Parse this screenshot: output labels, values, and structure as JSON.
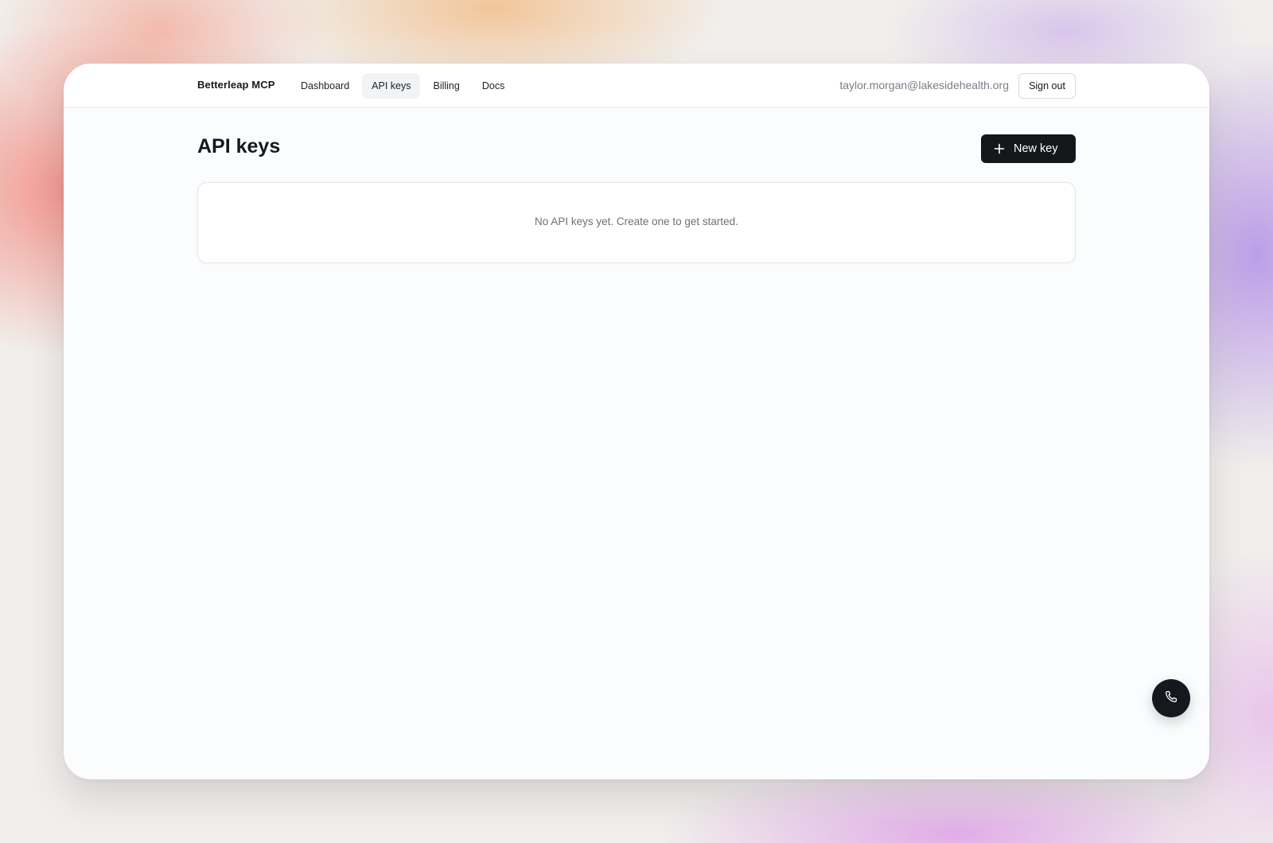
{
  "header": {
    "brand": "Betterleap MCP",
    "nav": [
      {
        "label": "Dashboard",
        "active": false
      },
      {
        "label": "API keys",
        "active": true
      },
      {
        "label": "Billing",
        "active": false
      },
      {
        "label": "Docs",
        "active": false
      }
    ],
    "user_email": "taylor.morgan@lakesidehealth.org",
    "sign_out_label": "Sign out"
  },
  "main": {
    "title": "API keys",
    "new_key_label": "New key",
    "new_key_icon": "plus-icon",
    "empty_state": "No API keys yet. Create one to get started."
  },
  "floating_action": {
    "icon": "phone-icon"
  },
  "colors": {
    "primary_button": "#15171b",
    "active_nav_bg": "#f2f3f5",
    "page_bg": "#fbfcfd",
    "muted_text": "#6c7078"
  }
}
